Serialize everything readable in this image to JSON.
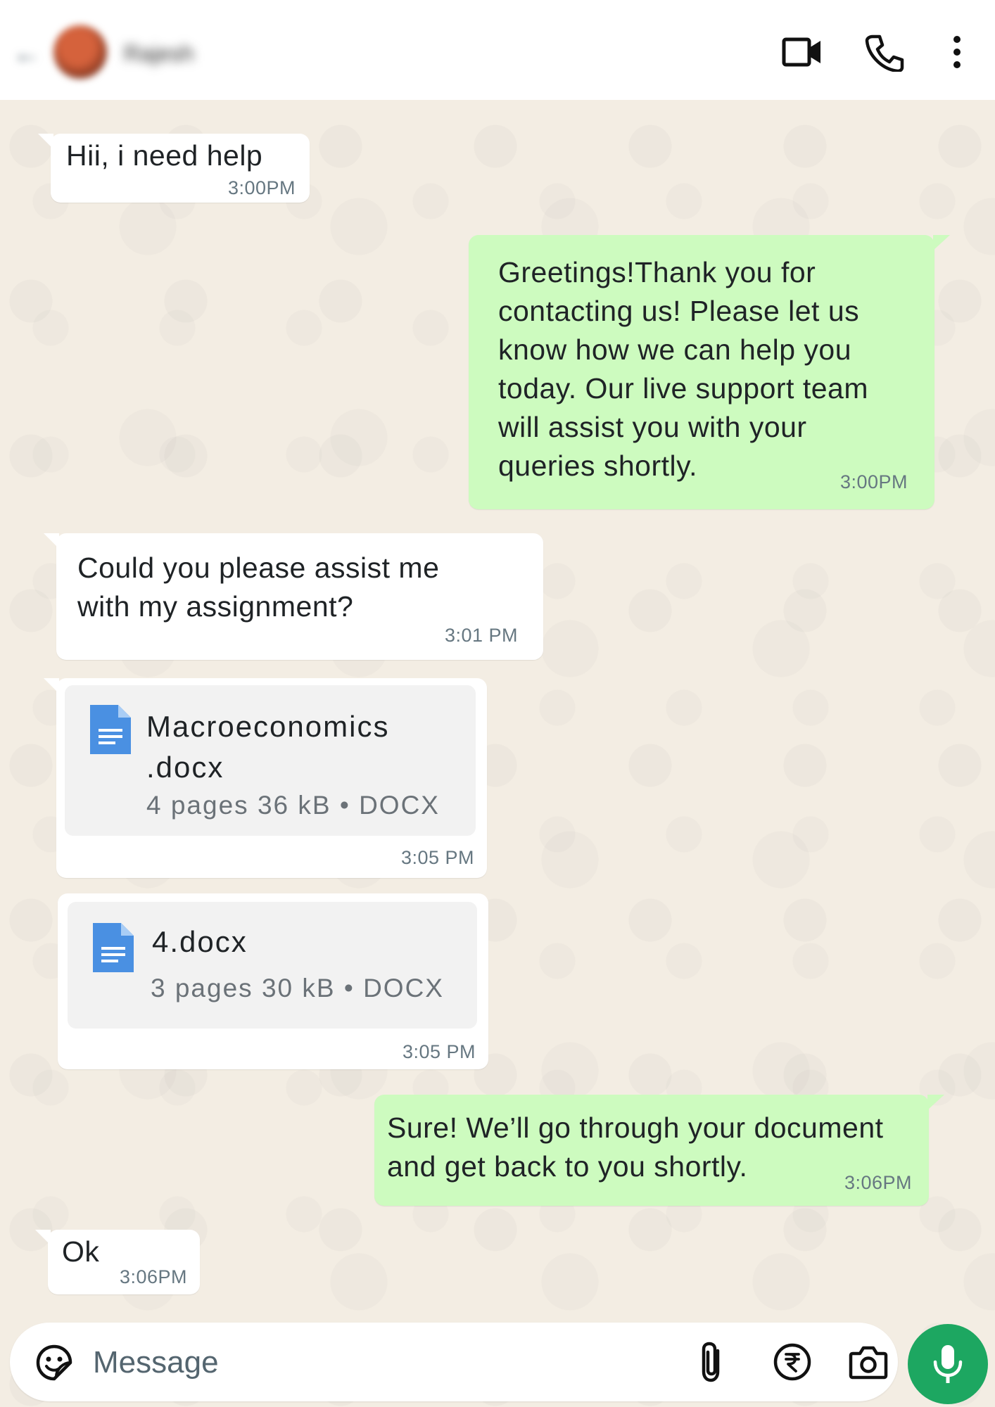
{
  "header": {
    "contact_name": "Rajesh",
    "icons": [
      "back-arrow-icon",
      "video-call-icon",
      "voice-call-icon",
      "more-options-icon"
    ]
  },
  "messages": [
    {
      "direction": "incoming",
      "text": "Hii, i need help",
      "time": "3:00PM"
    },
    {
      "direction": "outgoing",
      "text": "Greetings!Thank you for\ncontacting us! Please let us\nknow how we can help you\ntoday. Our live support team\nwill assist you with your\nqueries shortly.",
      "time": "3:00PM"
    },
    {
      "direction": "incoming",
      "text": "Could you please assist me\nwith my assignment?",
      "time": "3:01 PM"
    },
    {
      "direction": "incoming",
      "type": "document",
      "file_name": "Macroeconomics\n.docx",
      "meta": "4 pages 36 kB • DOCX",
      "time": "3:05 PM"
    },
    {
      "direction": "incoming",
      "type": "document",
      "file_name": "4.docx",
      "meta": "3 pages 30 kB • DOCX",
      "time": "3:05 PM"
    },
    {
      "direction": "outgoing",
      "text": "Sure! We’ll go through your document\nand get back to you shortly.",
      "time": "3:06PM"
    },
    {
      "direction": "incoming",
      "text": "Ok",
      "time": "3:06PM"
    }
  ],
  "composer": {
    "placeholder": "Message",
    "icons": [
      "emoji-icon",
      "attach-icon",
      "rupee-payment-icon",
      "camera-icon",
      "mic-icon"
    ]
  },
  "colors": {
    "outgoing_bubble": "#cdfbbf",
    "incoming_bubble": "#ffffff",
    "chat_background": "#f3ede3",
    "mic_button": "#1da761",
    "doc_icon": "#4a90e2"
  }
}
